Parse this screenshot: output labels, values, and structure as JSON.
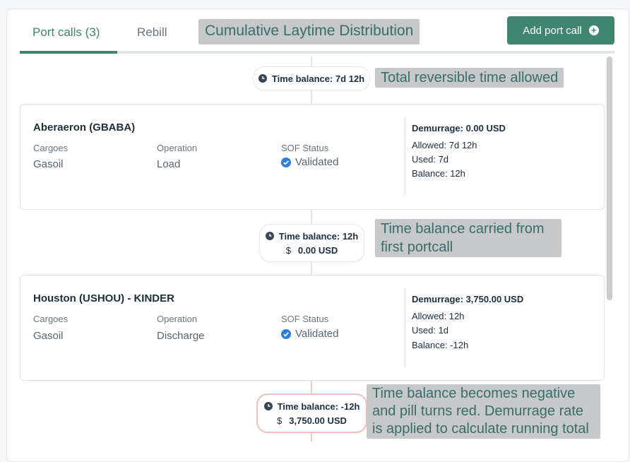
{
  "tabs": [
    {
      "label": "Port calls (3)",
      "active": true
    },
    {
      "label": "Rebill",
      "active": false
    }
  ],
  "overlay_title": "Cumulative Laytime Distribution",
  "add_button": {
    "label": "Add port call",
    "icon": "plus-circle-icon"
  },
  "colors": {
    "accent": "#3f8570",
    "negative_border": "#f2c0bb",
    "annotation_bg": "#c6c8ca",
    "annotation_text": "#3a6d67"
  },
  "timeline": [
    {
      "time_balance": "Time balance: 7d 12h",
      "amount": null,
      "negative": false,
      "note": "Total reversible time allowed"
    },
    {
      "time_balance": "Time balance: 12h",
      "amount": "0.00 USD",
      "negative": false,
      "note": "Time balance carried from first portcall"
    },
    {
      "time_balance": "Time balance: -12h",
      "amount": "3,750.00 USD",
      "negative": true,
      "note": "Time balance becomes negative and pill turns red. Demurrage rate is applied to calculate running total"
    }
  ],
  "port_calls": [
    {
      "name": "Aberaeron (GBABA)",
      "cargoes_label": "Cargoes",
      "cargoes": "Gasoil",
      "operation_label": "Operation",
      "operation": "Load",
      "sof_label": "SOF Status",
      "sof_status": "Validated",
      "demurrage": "Demurrage: 0.00 USD",
      "allowed": "Allowed: 7d 12h",
      "used": "Used: 7d",
      "balance": "Balance: 12h"
    },
    {
      "name": "Houston (USHOU) - KINDER",
      "cargoes_label": "Cargoes",
      "cargoes": "Gasoil",
      "operation_label": "Operation",
      "operation": "Discharge",
      "sof_label": "SOF Status",
      "sof_status": "Validated",
      "demurrage": "Demurrage: 3,750.00 USD",
      "allowed": "Allowed: 12h",
      "used": "Used: 1d",
      "balance": "Balance: -12h"
    }
  ]
}
